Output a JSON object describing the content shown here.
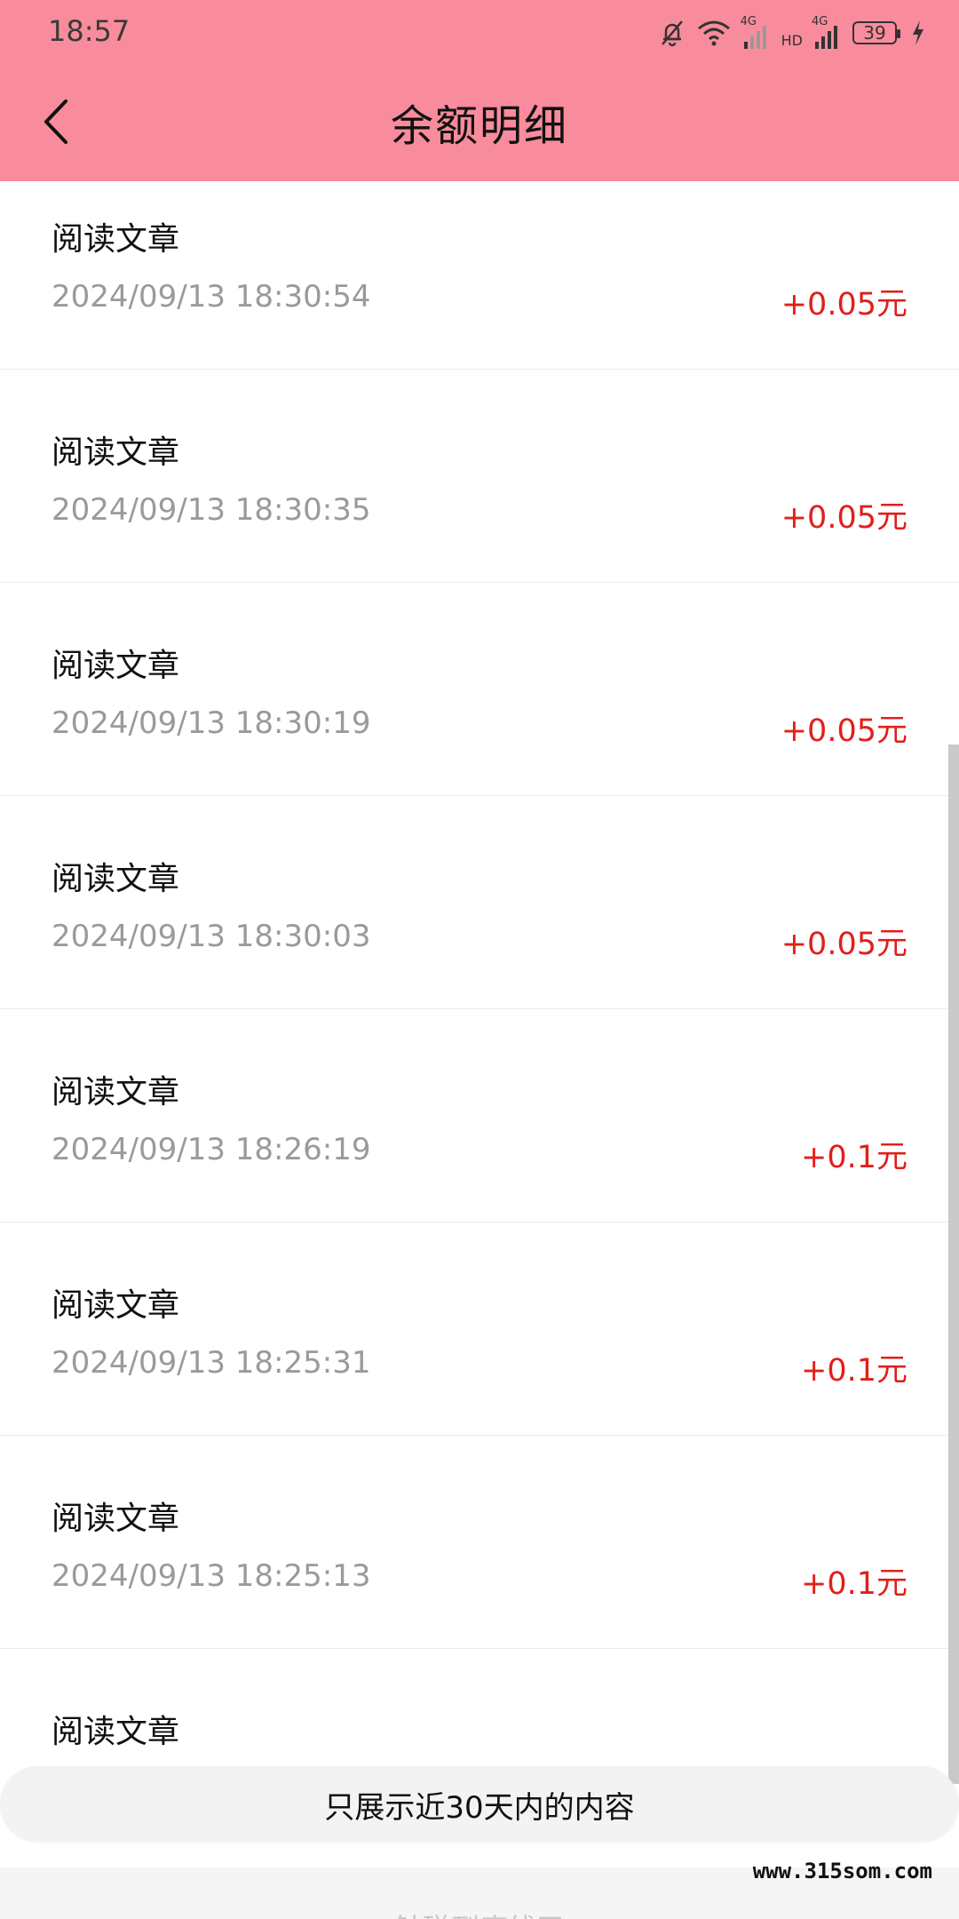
{
  "status_bar": {
    "time": "18:57",
    "battery": "39",
    "network_1": "4G",
    "network_2": "4G",
    "hd": "HD"
  },
  "header": {
    "title": "余额明细"
  },
  "records": [
    {
      "label": "阅读文章",
      "time": "2024/09/13 18:30:54",
      "amount": "+0.05元"
    },
    {
      "label": "阅读文章",
      "time": "2024/09/13 18:30:35",
      "amount": "+0.05元"
    },
    {
      "label": "阅读文章",
      "time": "2024/09/13 18:30:19",
      "amount": "+0.05元"
    },
    {
      "label": "阅读文章",
      "time": "2024/09/13 18:30:03",
      "amount": "+0.05元"
    },
    {
      "label": "阅读文章",
      "time": "2024/09/13 18:26:19",
      "amount": "+0.1元"
    },
    {
      "label": "阅读文章",
      "time": "2024/09/13 18:25:31",
      "amount": "+0.1元"
    },
    {
      "label": "阅读文章",
      "time": "2024/09/13 18:25:13",
      "amount": "+0.1元"
    },
    {
      "label": "阅读文章",
      "time": "",
      "amount": ""
    }
  ],
  "notice": "只展示近30天内的内容",
  "footer": "触碰到底线了",
  "watermark": "www.315som.com",
  "colors": {
    "header_bg": "#f98c9c",
    "amount": "#e0201a"
  }
}
